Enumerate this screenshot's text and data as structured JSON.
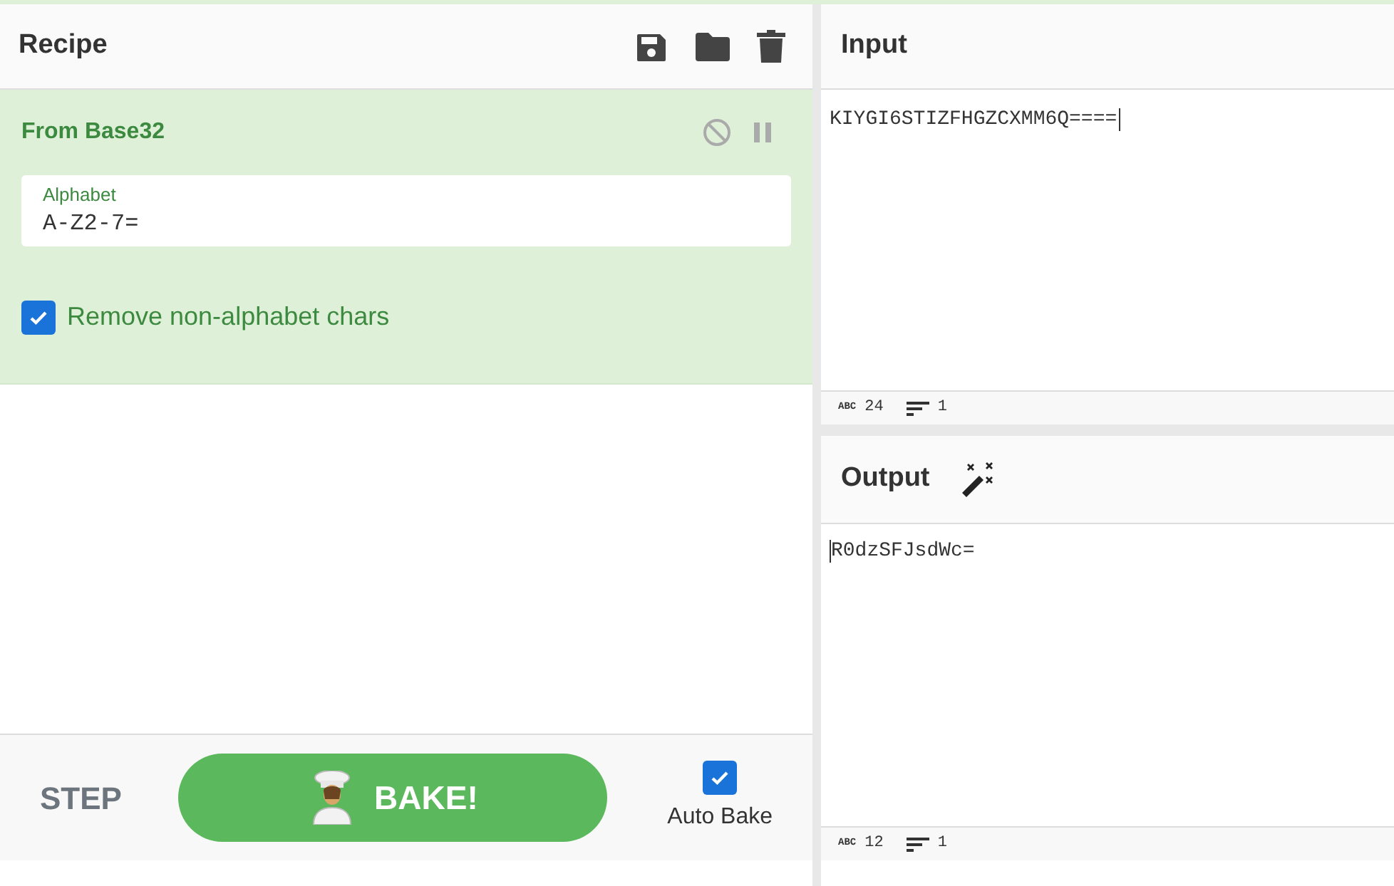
{
  "recipe": {
    "title": "Recipe"
  },
  "operation": {
    "name": "From Base32",
    "fields": [
      {
        "kind": "text",
        "label": "Alphabet",
        "value": "A-Z2-7="
      },
      {
        "kind": "checkbox",
        "label": "Remove non-alphabet chars",
        "checked": true
      }
    ]
  },
  "controls": {
    "step": "STEP",
    "bake": "BAKE!",
    "auto_bake": {
      "label": "Auto Bake",
      "checked": true
    }
  },
  "input": {
    "title": "Input",
    "value": "KIYGI6STIZFHGZCXMM6Q====",
    "abc": "ABC",
    "length": "24",
    "lines": "1"
  },
  "output": {
    "title": "Output",
    "value": "R0dzSFJsdWc=",
    "abc": "ABC",
    "length": "12",
    "lines": "1"
  }
}
